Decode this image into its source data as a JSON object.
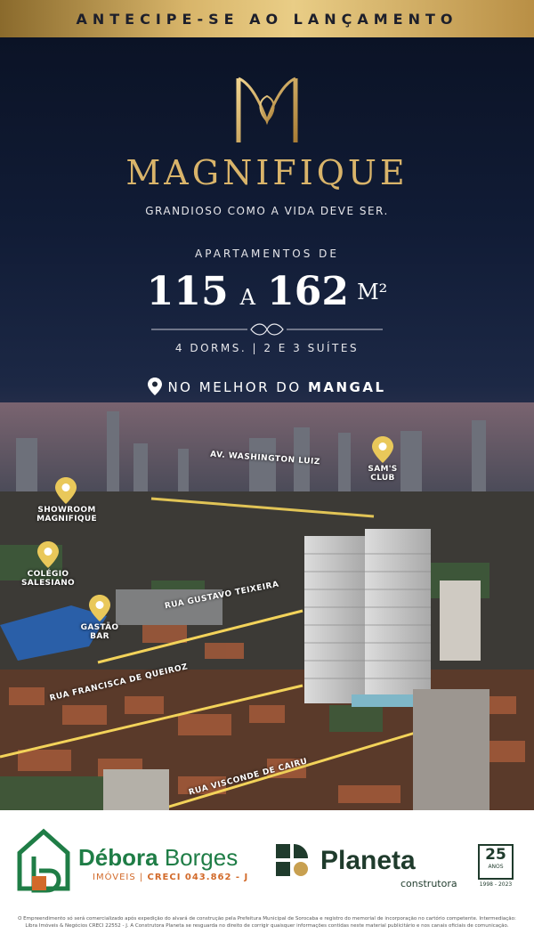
{
  "banner": {
    "text": "ANTECIPE-SE AO LANÇAMENTO"
  },
  "brand": {
    "name": "MAGNIFIQUE",
    "tagline": "GRANDIOSO COMO A VIDA DEVE SER."
  },
  "apartments": {
    "label": "APARTAMENTOS DE",
    "size_from": "115",
    "size_joiner": "A",
    "size_to": "162",
    "unit": "M²",
    "dorms": "4 DORMS. | 2 E 3 SUÍTES"
  },
  "location": {
    "prefix": "NO MELHOR DO",
    "highlight": "MANGAL"
  },
  "map": {
    "pins": [
      {
        "label_line1": "SHOWROOM",
        "label_line2": "MAGNIFIQUE"
      },
      {
        "label_line1": "COLÉGIO",
        "label_line2": "SALESIANO"
      },
      {
        "label_line1": "GASTÃO",
        "label_line2": "BAR"
      },
      {
        "label_line1": "SAM'S",
        "label_line2": "CLUB"
      }
    ],
    "streets": [
      "AV. WASHINGTON LUIZ",
      "RUA GUSTAVO TEIXEIRA",
      "RUA FRANCISCA DE QUEIROZ",
      "RUA VISCONDE DE CAIRU"
    ]
  },
  "footer": {
    "broker_first": "Débora",
    "broker_last": "Borges",
    "broker_sub": "IMÓVEIS",
    "broker_sep": "|",
    "creci": "CRECI 043.862 - J",
    "builder": "Planeta",
    "builder_sub": "construtora",
    "anniversary_num": "25",
    "anniversary_label": "ANOS",
    "anniversary_years": "1998 - 2023",
    "disclaimer": "O Empreendimento só será comercializado após expedição do alvará de construção pela Prefeitura Municipal de Sorocaba e registro do memorial de incorporação no cartório competente. Intermediação: Libra Imóveis & Negócios CRECI 22552 - J. A Construtora Planeta se resguarda no direito de corrigir quaisquer informações contidas neste material publicitário e nos canais oficiais de comunicação."
  },
  "colors": {
    "gold": "#d9b46a",
    "navy": "#111c36",
    "broker_green": "#1f7d46",
    "broker_orange": "#d26a2a",
    "builder_green": "#1f3b2c"
  }
}
